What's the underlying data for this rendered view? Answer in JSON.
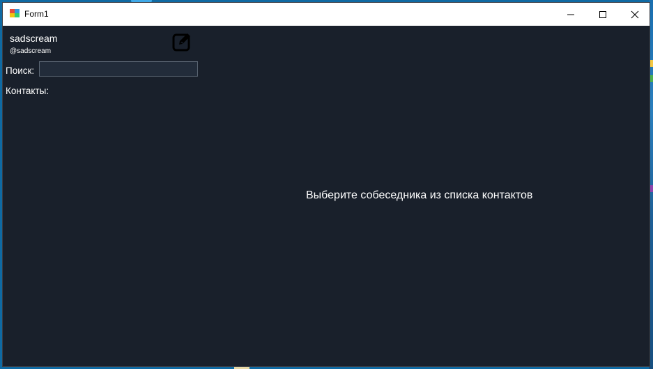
{
  "window": {
    "title": "Form1",
    "controls": {
      "minimize": "minimize",
      "maximize": "maximize",
      "close": "close"
    }
  },
  "profile": {
    "name": "sadscream",
    "handle": "@sadscream",
    "edit_icon": "edit-icon"
  },
  "search": {
    "label": "Поиск:",
    "value": "",
    "placeholder": ""
  },
  "contacts": {
    "label": "Контакты:",
    "items": []
  },
  "chat": {
    "placeholder_text": "Выберите собеседника из списка контактов"
  },
  "colors": {
    "background": "#19202b",
    "titlebar": "#ffffff",
    "text": "#ffffff",
    "input_bg": "#222c3a"
  }
}
